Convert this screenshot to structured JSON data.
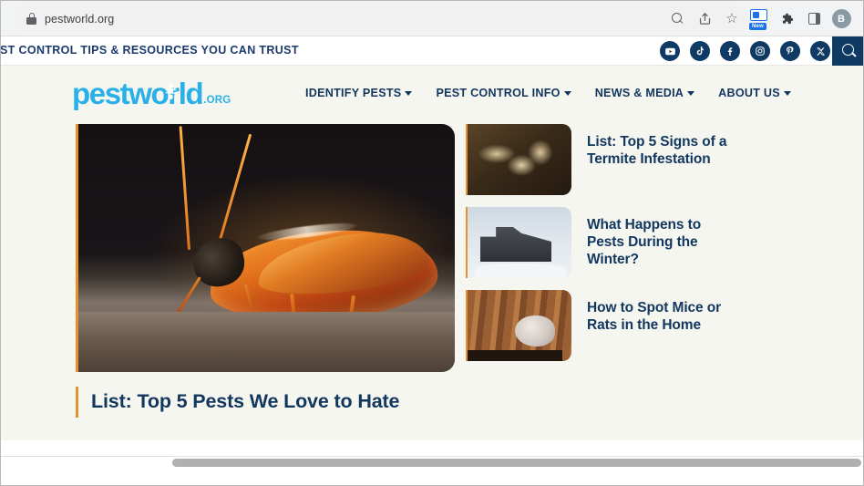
{
  "browser": {
    "url": "pestworld.org",
    "lock_icon": "lock-icon",
    "toolbar_icons": [
      {
        "name": "search-icon",
        "label": "Search"
      },
      {
        "name": "share-icon",
        "label": "Share"
      },
      {
        "name": "bookmark-star-icon",
        "label": "Bookmark"
      },
      {
        "name": "side-search-new-icon",
        "label": "New"
      },
      {
        "name": "extensions-puzzle-icon",
        "label": "Extensions"
      },
      {
        "name": "side-panel-icon",
        "label": "Side panel"
      },
      {
        "name": "profile-avatar",
        "label": "B"
      }
    ],
    "profile_initial": "B",
    "new_badge": "New"
  },
  "site": {
    "announcement": "ST CONTROL TIPS & RESOURCES YOU CAN TRUST",
    "logo": {
      "word": "pestworld",
      "suffix": ".ORG"
    },
    "social": [
      {
        "name": "youtube-icon",
        "label": "YouTube"
      },
      {
        "name": "tiktok-icon",
        "label": "TikTok"
      },
      {
        "name": "facebook-icon",
        "label": "Facebook"
      },
      {
        "name": "instagram-icon",
        "label": "Instagram"
      },
      {
        "name": "pinterest-icon",
        "label": "Pinterest"
      },
      {
        "name": "x-twitter-icon",
        "label": "X"
      }
    ],
    "search_button": "Search",
    "nav": [
      {
        "label": "IDENTIFY PESTS"
      },
      {
        "label": "PEST CONTROL INFO"
      },
      {
        "label": "NEWS & MEDIA"
      },
      {
        "label": "ABOUT US"
      }
    ]
  },
  "hero": {
    "title": "List: Top 5 Pests We Love to Hate",
    "image_alt": "Close-up of a cockroach on a counter"
  },
  "articles": [
    {
      "title": "List: Top 5 Signs of a Termite Infestation",
      "image_alt": "Termites in soil and wood"
    },
    {
      "title": "What Happens to Pests During the Winter?",
      "image_alt": "Snow covered house in winter"
    },
    {
      "title": "How to Spot Mice or Rats in the Home",
      "image_alt": "Mouse between stacked books"
    }
  ],
  "colors": {
    "navy": "#12375f",
    "logo_blue": "#29b0e8",
    "accent_orange": "#e8912a",
    "social_navy": "#0e3a63",
    "page_bg": "#f6f6f1"
  }
}
